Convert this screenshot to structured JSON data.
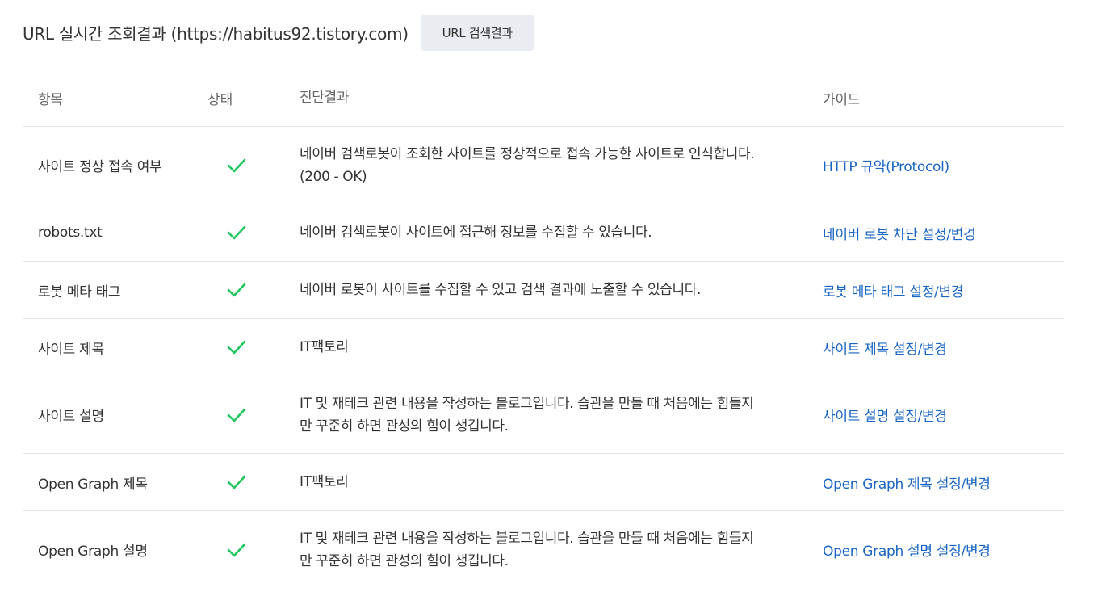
{
  "header": {
    "title": "URL 실시간 조회결과 (https://habitus92.tistory.com)",
    "search_result_button": "URL 검색결과"
  },
  "table": {
    "columns": {
      "item": "항목",
      "status": "상태",
      "result": "진단결과",
      "guide": "가이드"
    },
    "rows": [
      {
        "item": "사이트 정상 접속 여부",
        "status": "ok",
        "result_line1": "네이버 검색로봇이 조회한 사이트를 정상적으로 접속 가능한 사이트로 인식합니다.",
        "result_line2": "(200 - OK)",
        "guide": "HTTP 규약(Protocol)"
      },
      {
        "item": "robots.txt",
        "status": "ok",
        "result_line1": "네이버 검색로봇이 사이트에 접근해 정보를 수집할 수 있습니다.",
        "result_line2": "",
        "guide": "네이버 로봇 차단 설정/변경"
      },
      {
        "item": "로봇 메타 태그",
        "status": "ok",
        "result_line1": "네이버 로봇이 사이트를 수집할 수 있고 검색 결과에 노출할 수 있습니다.",
        "result_line2": "",
        "guide": "로봇 메타 태그 설정/변경"
      },
      {
        "item": "사이트 제목",
        "status": "ok",
        "result_line1": "IT팩토리",
        "result_line2": "",
        "guide": "사이트 제목 설정/변경"
      },
      {
        "item": "사이트 설명",
        "status": "ok",
        "result_line1": "IT 및 재테크 관련 내용을 작성하는 블로그입니다. 습관을 만들 때 처음에는 힘들지",
        "result_line2": "만 꾸준히 하면 관성의 힘이 생깁니다.",
        "guide": "사이트 설명 설정/변경"
      },
      {
        "item": "Open Graph 제목",
        "status": "ok",
        "result_line1": "IT팩토리",
        "result_line2": "",
        "guide": "Open Graph 제목 설정/변경"
      },
      {
        "item": "Open Graph 설명",
        "status": "ok",
        "result_line1": "IT 및 재테크 관련 내용을 작성하는 블로그입니다. 습관을 만들 때 처음에는 힘들지",
        "result_line2": "만 꾸준히 하면 관성의 힘이 생깁니다.",
        "guide": "Open Graph 설명 설정/변경"
      }
    ]
  },
  "colors": {
    "check": "#1fc75d",
    "link": "#1a66c4",
    "button_bg": "#e9edf1",
    "divider": "#e4e4e4"
  },
  "icons": {
    "status_ok": "check-icon"
  }
}
